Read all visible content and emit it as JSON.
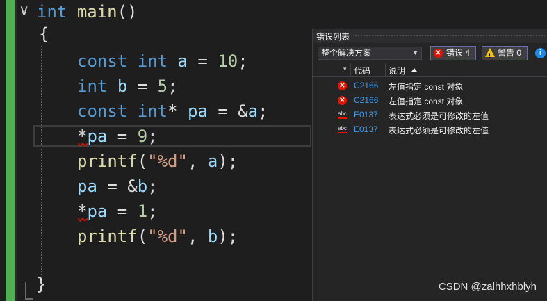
{
  "editor": {
    "lines": {
      "l0": {
        "kw": "int",
        "fn": "main",
        "rest": "()"
      },
      "l1": {
        "brace_open": "{"
      },
      "l2": {
        "kw1": "const",
        "kw2": "int",
        "var": "a",
        "op": " = ",
        "num": "10",
        "end": ";"
      },
      "l3": {
        "kw": "int",
        "var": "b",
        "op": " = ",
        "num": "5",
        "end": ";"
      },
      "l4": {
        "kw1": "const",
        "kw2": "int",
        "star": "*",
        "var": "pa",
        "op": " = &",
        "var2": "a",
        "end": ";"
      },
      "l5": {
        "star": "*",
        "var": "pa",
        "op": " = ",
        "num": "9",
        "end": ";"
      },
      "l6": {
        "fn": "printf",
        "open": "(",
        "str": "\"%d\"",
        "comma": ", ",
        "var": "a",
        "end": ");"
      },
      "l7": {
        "var": "pa",
        "op": " = &",
        "var2": "b",
        "end": ";"
      },
      "l8": {
        "star": "*",
        "var": "pa",
        "op": " = ",
        "num": "1",
        "end": ";"
      },
      "l9": {
        "fn": "printf",
        "open": "(",
        "str": "\"%d\"",
        "comma": ", ",
        "var": "b",
        "end": ");"
      },
      "l10": {
        "brace_close": "}"
      }
    },
    "fold_glyph": "∨"
  },
  "error_list": {
    "title": "错误列表",
    "scope": "整个解决方案",
    "errors_label": "错误 4",
    "warnings_label": "警告 0",
    "columns": {
      "code": "代码",
      "description": "说明"
    },
    "rows": [
      {
        "icon": "error-icon",
        "code": "C2166",
        "description": "左值指定 const 对象"
      },
      {
        "icon": "error-icon",
        "code": "C2166",
        "description": "左值指定 const 对象"
      },
      {
        "icon": "spell-error-icon",
        "code": "E0137",
        "description": "表达式必须是可修改的左值"
      },
      {
        "icon": "spell-error-icon",
        "code": "E0137",
        "description": "表达式必须是可修改的左值"
      }
    ]
  },
  "watermark": "CSDN @zalhhxhblyh",
  "colors": {
    "editor_bg": "#1e1e1e",
    "keyword": "#569cd6",
    "variable": "#9cdcfe",
    "number": "#b5cea8",
    "string": "#d69d85",
    "function": "#dcdcaa",
    "change_bar": "#4caf50",
    "error_red": "#e51400",
    "warning_yellow": "#f5c400",
    "link_blue": "#3e9be8"
  }
}
